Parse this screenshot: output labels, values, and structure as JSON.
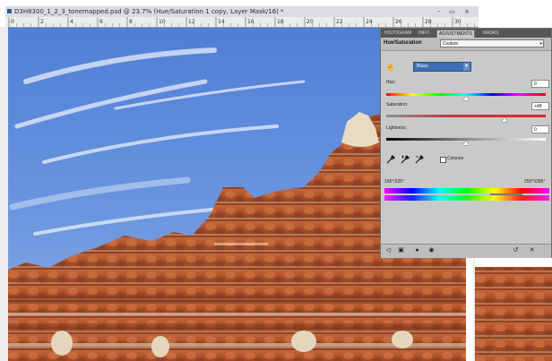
{
  "window": {
    "title": "D3H8300_1_2_3_tonemapped.psd @ 23.7% (Hue/Saturation 1 copy, Layer Mask/16) *",
    "controls": "- ▭ ×"
  },
  "ruler": {
    "ticks": [
      "0",
      "2",
      "4",
      "6",
      "8",
      "10",
      "12",
      "14",
      "16",
      "18",
      "20",
      "22",
      "24",
      "26",
      "28",
      "30"
    ]
  },
  "panel": {
    "tabs": [
      "HISTOGRAM",
      "INFO",
      "ADJUSTMENTS",
      "MASKS"
    ],
    "active_tab": "ADJUSTMENTS",
    "title": "Hue/Saturation",
    "preset": "Custom",
    "channel": "Blues",
    "sliders": {
      "hue": {
        "label": "Hue:",
        "value": "0",
        "level": 0.5
      },
      "saturation": {
        "label": "Saturation:",
        "value": "+48",
        "level": 0.74
      },
      "lightness": {
        "label": "Lightness:",
        "value": "0",
        "level": 0.5
      }
    },
    "colorize_label": "Colorize",
    "colorize_checked": false,
    "range_left": "195°/225°",
    "range_right": "255°\\/285°"
  },
  "colors": {
    "sky": "#5b86d8",
    "rock": "#b5542b",
    "panel_bg": "#c9c9c9",
    "selection_blue": "#3d6fb6"
  },
  "icons": {
    "edit_in_image": "hand-arrows-icon",
    "eyedroppers": [
      "eyedropper-icon",
      "eyedropper-plus-icon",
      "eyedropper-minus-icon"
    ],
    "footer_left": [
      "back-icon",
      "expand-icon",
      "clip-icon",
      "visibility-icon"
    ],
    "footer_right": [
      "reset-icon",
      "delete-icon"
    ]
  }
}
